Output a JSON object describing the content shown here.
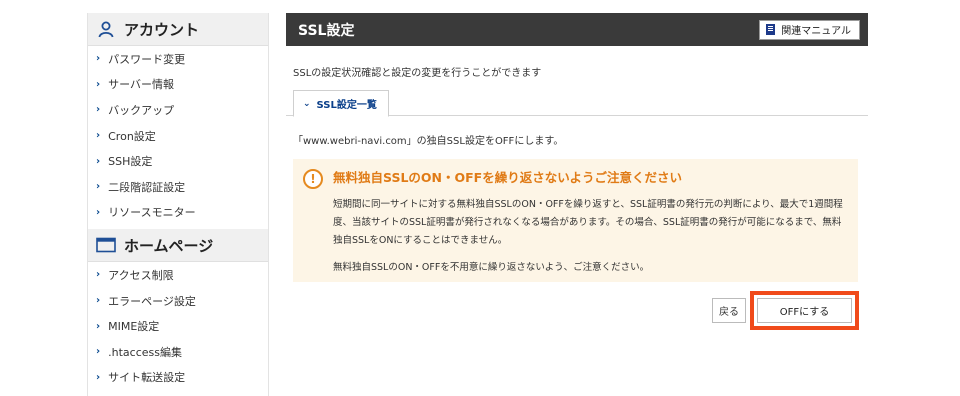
{
  "sidebar": {
    "account_title": "アカウント",
    "account_items": [
      {
        "label": "パスワード変更"
      },
      {
        "label": "サーバー情報"
      },
      {
        "label": "バックアップ"
      },
      {
        "label": "Cron設定"
      },
      {
        "label": "SSH設定"
      },
      {
        "label": "二段階認証設定"
      },
      {
        "label": "リソースモニター"
      }
    ],
    "homepage_title": "ホームページ",
    "homepage_items": [
      {
        "label": "アクセス制限"
      },
      {
        "label": "エラーページ設定"
      },
      {
        "label": "MIME設定"
      },
      {
        "label": ".htaccess編集"
      },
      {
        "label": "サイト転送設定"
      }
    ]
  },
  "main": {
    "title": "SSL設定",
    "manual_label": "関連マニュアル",
    "description": "SSLの設定状況確認と設定の変更を行うことができます",
    "tab_label": "SSL設定一覧",
    "notice": "「www.webri-navi.com」の独自SSL設定をOFFにします。",
    "warning": {
      "title": "無料独自SSLのON・OFFを繰り返さないようご注意ください",
      "body1": "短期間に同一サイトに対する無料独自SSLのON・OFFを繰り返すと、SSL証明書の発行元の判断により、最大で1週間程度、当該サイトのSSL証明書が発行されなくなる場合があります。その場合、SSL証明書の発行が可能になるまで、無料独自SSLをONにすることはできません。",
      "body2": "無料独自SSLのON・OFFを不用意に繰り返さないよう、ご注意ください。"
    },
    "back_label": "戻る",
    "off_label": "OFFにする"
  },
  "colors": {
    "accent_orange": "#e07b16",
    "highlight_red": "#f04a1a",
    "link_blue": "#0a3f8a",
    "titlebar": "#3a3a3a"
  }
}
